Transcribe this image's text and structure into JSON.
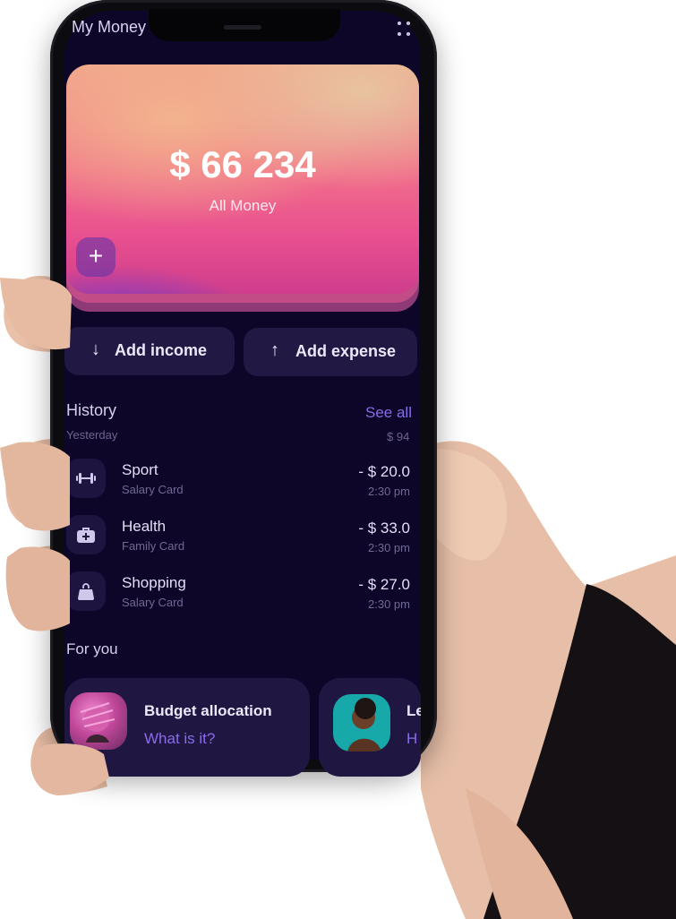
{
  "app": {
    "title": "My Money"
  },
  "balance": {
    "amount": "$ 66 234",
    "label": "All Money"
  },
  "actions": {
    "income": "Add income",
    "expense": "Add expense"
  },
  "history": {
    "title": "History",
    "see_all": "See all",
    "day": "Yesterday",
    "day_total": "$ 94",
    "items": [
      {
        "name": "Sport",
        "card": "Salary Card",
        "amount": "- $ 20.0",
        "time": "2:30 pm",
        "icon": "dumbbell-icon"
      },
      {
        "name": "Health",
        "card": "Family Card",
        "amount": "- $ 33.0",
        "time": "2:30 pm",
        "icon": "first-aid-kit-icon"
      },
      {
        "name": "Shopping",
        "card": "Salary Card",
        "amount": "- $ 27.0",
        "time": "2:30 pm",
        "icon": "shopping-bag-icon"
      }
    ]
  },
  "for_you": {
    "title": "For you",
    "cards": [
      {
        "title": "Budget allocation",
        "link": "What is it?"
      },
      {
        "title": "Le",
        "link": "H"
      }
    ]
  },
  "colors": {
    "accent": "#8a6be8",
    "background": "#0e0628",
    "surface": "#211844"
  }
}
